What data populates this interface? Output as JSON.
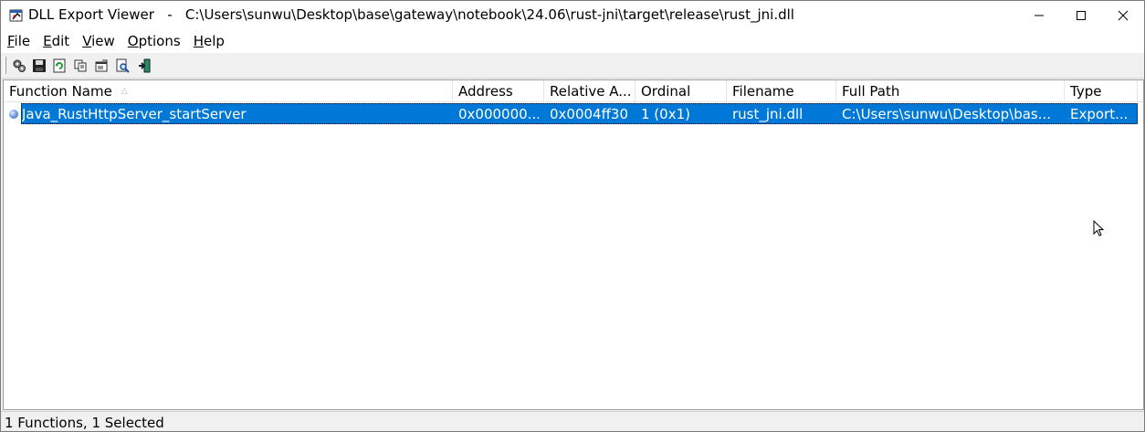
{
  "window": {
    "app_name": "DLL Export Viewer",
    "separator": "-",
    "file_path": "C:\\Users\\sunwu\\Desktop\\base\\gateway\\notebook\\24.06\\rust-jni\\target\\release\\rust_jni.dll",
    "app_icon": "dll-export-viewer-icon"
  },
  "menu": {
    "items": [
      {
        "label": "File",
        "accel": "F",
        "rest": "ile"
      },
      {
        "label": "Edit",
        "accel": "E",
        "rest": "dit"
      },
      {
        "label": "View",
        "accel": "V",
        "rest": "iew"
      },
      {
        "label": "Options",
        "accel": "O",
        "rest": "ptions"
      },
      {
        "label": "Help",
        "accel": "H",
        "rest": "elp"
      }
    ]
  },
  "toolbar": {
    "buttons": [
      "gears-icon",
      "save-icon",
      "refresh-icon",
      "copy-icon",
      "properties-icon",
      "find-icon",
      "exit-icon"
    ]
  },
  "table": {
    "columns": [
      "Function Name",
      "Address",
      "Relative A...",
      "Ordinal",
      "Filename",
      "Full Path",
      "Type"
    ],
    "sort_column": "Function Name",
    "rows": [
      {
        "function_name": "Java_RustHttpServer_startServer",
        "address": "0x000000...",
        "relative_address": "0x0004ff30",
        "ordinal": "1 (0x1)",
        "filename": "rust_jni.dll",
        "full_path": "C:\\Users\\sunwu\\Desktop\\bas...",
        "type": "Export...",
        "selected": true
      }
    ]
  },
  "status": {
    "text": "1 Functions, 1 Selected"
  },
  "colors": {
    "selection": "#0078d7",
    "window_bg": "#f0f0f0"
  }
}
